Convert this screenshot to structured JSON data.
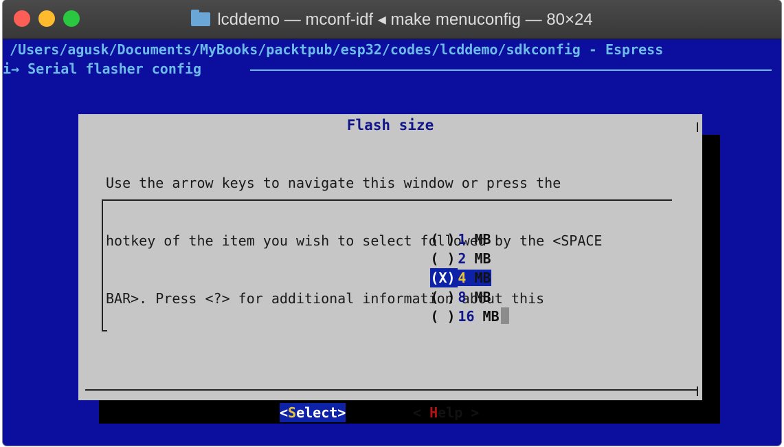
{
  "window": {
    "title": "lcddemo — mconf-idf ◂ make menuconfig — 80×24"
  },
  "terminal": {
    "path_line": "/Users/agusk/Documents/MyBooks/packtpub/esp32/codes/lcddemo/sdkconfig - Espress",
    "breadcrumb": "i→ Serial flasher config"
  },
  "dialog": {
    "title": "Flash size",
    "help_lines": [
      "Use the arrow keys to navigate this window or press the",
      "hotkey of the item you wish to select followed by the <SPACE",
      "BAR>. Press <?> for additional information about this"
    ],
    "options": [
      {
        "mark": "( )",
        "hot": "1",
        "rest": " MB",
        "selected": false
      },
      {
        "mark": "( )",
        "hot": "2",
        "rest": " MB",
        "selected": false
      },
      {
        "mark": "(X)",
        "hot": "4",
        "rest": " MB",
        "selected": true
      },
      {
        "mark": "( )",
        "hot": "8",
        "rest": " MB",
        "selected": false
      },
      {
        "mark": "( )",
        "hot": "16",
        "rest": " MB",
        "selected": false
      }
    ],
    "buttons": {
      "select": {
        "open": "<",
        "hot": "S",
        "rest": "elect>"
      },
      "help": {
        "open": "< ",
        "hot": "H",
        "rest": "elp >"
      }
    }
  }
}
